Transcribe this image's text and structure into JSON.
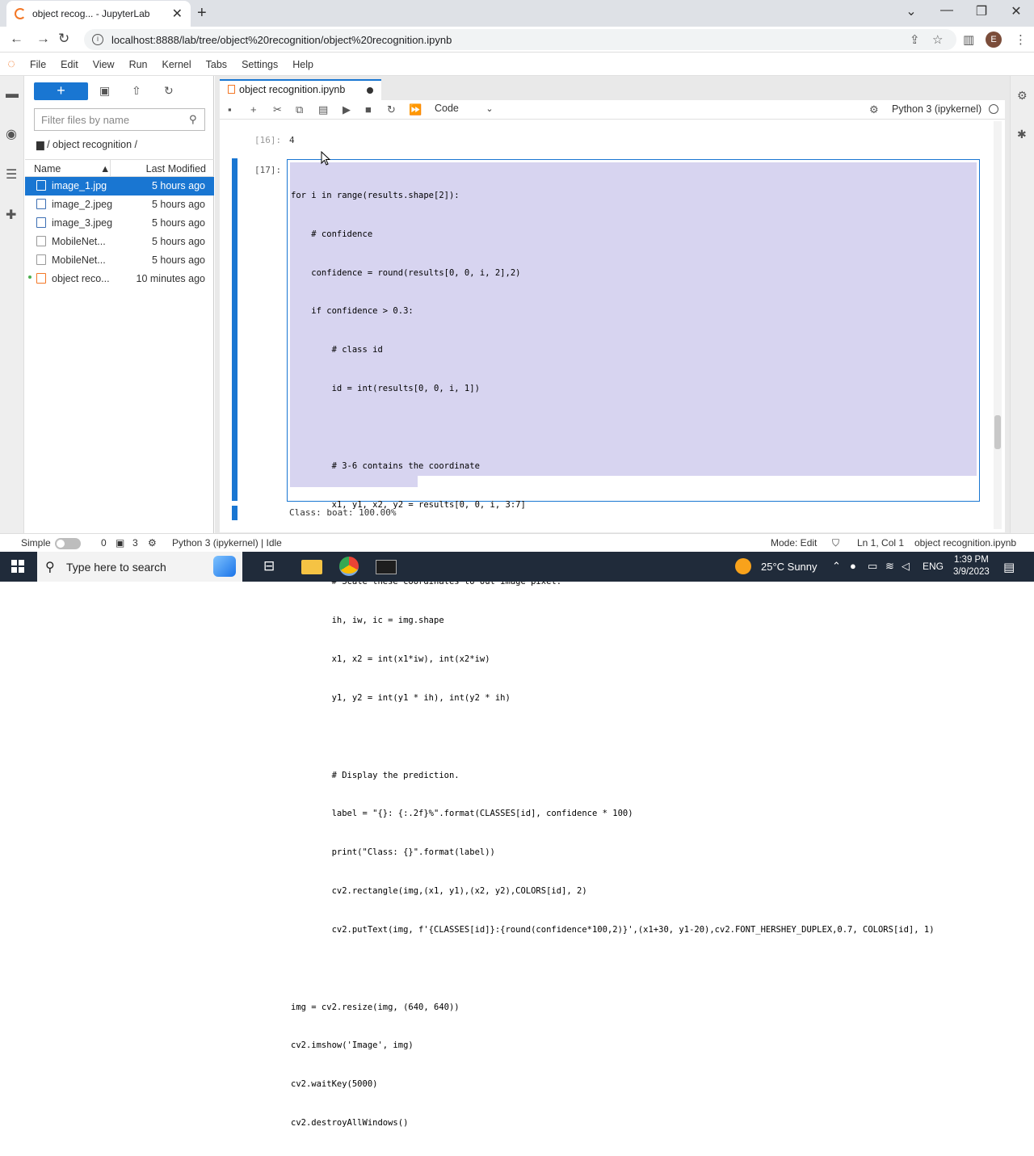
{
  "browser": {
    "tab_title": "object recog... - JupyterLab",
    "url": "localhost:8888/lab/tree/object%20recognition/object%20recognition.ipynb",
    "profile_initial": "E"
  },
  "menubar": {
    "items": [
      "File",
      "Edit",
      "View",
      "Run",
      "Kernel",
      "Tabs",
      "Settings",
      "Help"
    ]
  },
  "filebrowser": {
    "new_label": "+",
    "filter_placeholder": "Filter files by name",
    "breadcrumb": "/ object recognition /",
    "col_name": "Name",
    "col_modified": "Last Modified",
    "files": [
      {
        "name": "image_1.jpg",
        "modified": "5 hours ago",
        "type": "image",
        "selected": true
      },
      {
        "name": "image_2.jpeg",
        "modified": "5 hours ago",
        "type": "image",
        "selected": false
      },
      {
        "name": "image_3.jpeg",
        "modified": "5 hours ago",
        "type": "image",
        "selected": false
      },
      {
        "name": "MobileNet...",
        "modified": "5 hours ago",
        "type": "file",
        "selected": false
      },
      {
        "name": "MobileNet...",
        "modified": "5 hours ago",
        "type": "file",
        "selected": false
      },
      {
        "name": "object reco...",
        "modified": "10 minutes ago",
        "type": "notebook",
        "selected": false
      }
    ]
  },
  "notebook": {
    "tab_label": "object recognition.ipynb",
    "cell_type": "Code",
    "kernel": "Python 3 (ipykernel)",
    "prev_prompt": "[16]:",
    "prev_output": "4",
    "cell_prompt": "[17]:",
    "code_lines": [
      "for i in range(results.shape[2]):",
      "    # confidence",
      "    confidence = round(results[0, 0, i, 2],2)",
      "    if confidence > 0.3:",
      "        # class id",
      "        id = int(results[0, 0, i, 1])",
      "",
      "        # 3-6 contains the coordinate",
      "        x1, y1, x2, y2 = results[0, 0, i, 3:7]",
      "",
      "        # Scale these coordinates to out image pixel.",
      "        ih, iw, ic = img.shape",
      "        x1, x2 = int(x1*iw), int(x2*iw)",
      "        y1, y2 = int(y1 * ih), int(y2 * ih)",
      "",
      "        # Display the prediction.",
      "        label = \"{}: {:.2f}%\".format(CLASSES[id], confidence * 100)",
      "        print(\"Class: {}\".format(label))",
      "        cv2.rectangle(img,(x1, y1),(x2, y2),COLORS[id], 2)",
      "        cv2.putText(img, f'{CLASSES[id]}:{round(confidence*100,2)}',(x1+30, y1-20),cv2.FONT_HERSHEY_DUPLEX,0.7, COLORS[id], 1)",
      "",
      "img = cv2.resize(img, (640, 640))",
      "cv2.imshow('Image', img)",
      "cv2.waitKey(5000)",
      "cv2.destroyAllWindows()"
    ],
    "output_text": "Class: boat: 100.00%"
  },
  "statusbar": {
    "mode_label": "Simple",
    "terminals": "0",
    "kernels": "3",
    "kernel_status": "Python 3 (ipykernel) | Idle",
    "mode": "Mode: Edit",
    "position": "Ln 1, Col 1",
    "filename": "object recognition.ipynb"
  },
  "taskbar": {
    "search_placeholder": "Type here to search",
    "weather": "25°C  Sunny",
    "language": "ENG",
    "time": "1:39 PM",
    "date": "3/9/2023"
  },
  "colors": {
    "accent": "#1976d2",
    "jupyter_orange": "#f37726",
    "selection": "#d7d4f0",
    "taskbar": "#202b3a"
  }
}
